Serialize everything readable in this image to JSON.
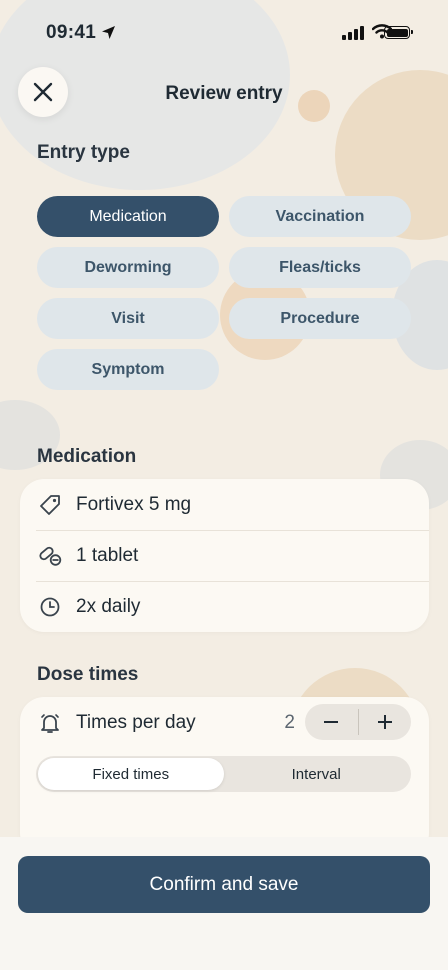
{
  "status": {
    "time": "09:41"
  },
  "header": {
    "title": "Review entry"
  },
  "entry_type": {
    "label": "Entry type",
    "options": [
      "Medication",
      "Vaccination",
      "Deworming",
      "Fleas/ticks",
      "Visit",
      "Procedure",
      "Symptom"
    ],
    "selected": "Medication"
  },
  "medication": {
    "label": "Medication",
    "name": "Fortivex 5 mg",
    "amount": "1 tablet",
    "frequency": "2x daily"
  },
  "dose_times": {
    "label": "Dose times",
    "times_per_day_label": "Times per day",
    "times_per_day_value": "2",
    "segment": {
      "fixed": "Fixed times",
      "interval": "Interval",
      "selected": "Fixed times"
    }
  },
  "footer": {
    "confirm_label": "Confirm and save"
  },
  "colors": {
    "accent": "#34506a",
    "chip_bg": "#dfe6ea",
    "background": "#f3ede3"
  }
}
